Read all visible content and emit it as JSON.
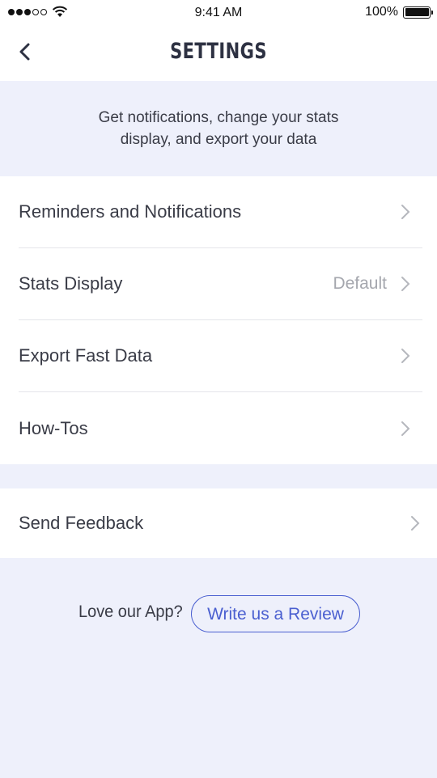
{
  "status_bar": {
    "time": "9:41 AM",
    "battery": "100%"
  },
  "nav": {
    "title": "SETTINGS",
    "back_icon": "chevron-left-icon"
  },
  "intro": {
    "text": "Get notifications, change your stats display, and export your data"
  },
  "settings_items": [
    {
      "label": "Reminders and Notifications",
      "value": ""
    },
    {
      "label": "Stats Display",
      "value": "Default"
    },
    {
      "label": "Export Fast Data",
      "value": ""
    },
    {
      "label": "How-Tos",
      "value": ""
    }
  ],
  "feedback": {
    "label": "Send Feedback"
  },
  "review": {
    "question": "Love our App?",
    "button_label": "Write us a Review"
  },
  "colors": {
    "accent": "#4a5fd0",
    "background": "#eef0fb",
    "text": "#3a3c47"
  }
}
